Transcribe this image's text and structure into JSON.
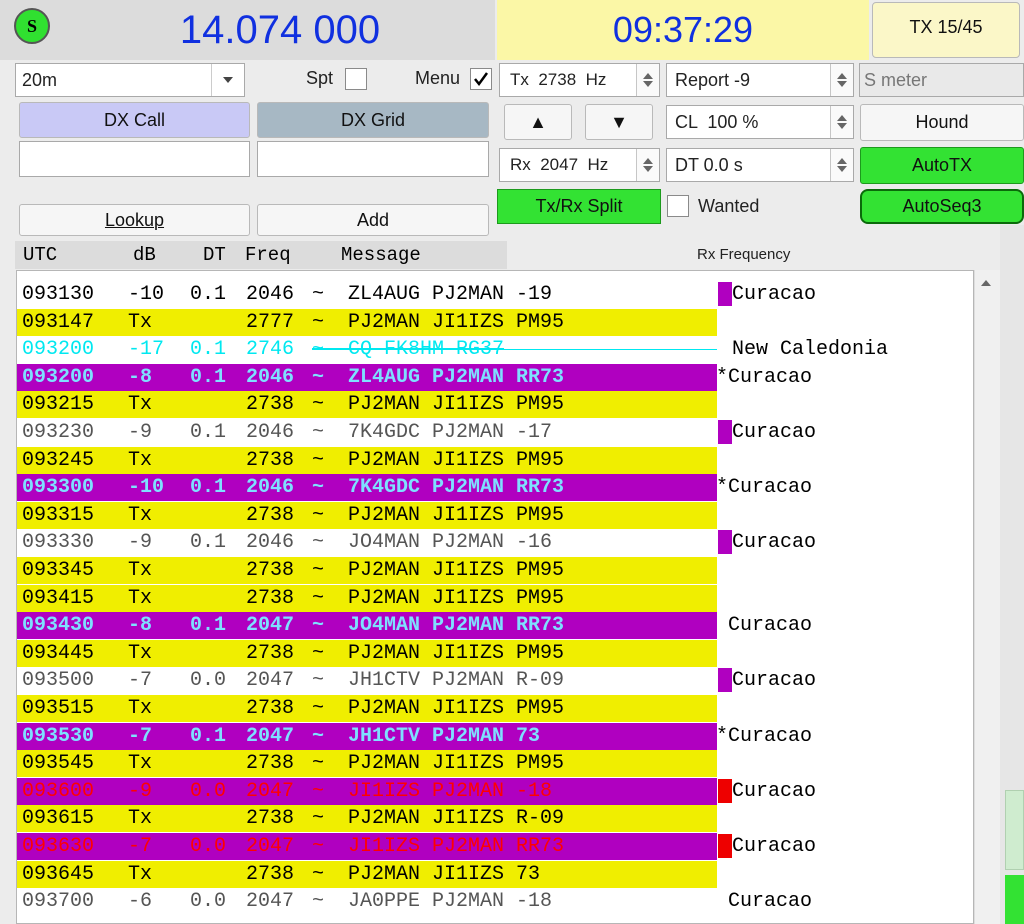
{
  "header": {
    "frequency": "14.074 000",
    "clock": "09:37:29",
    "tx_status": "TX 15/45",
    "s_indicator": "S"
  },
  "controls": {
    "band": "20m",
    "spt_label": "Spt",
    "menu_label": "Menu",
    "tx_freq": "Tx  2738  Hz",
    "rx_freq": "Rx  2047  Hz",
    "report": "Report -9",
    "s_meter_placeholder": "S meter",
    "cl": "CL  100 %",
    "dt": "DT 0.0 s",
    "hound": "Hound",
    "autotx": "AutoTX",
    "autoseq": "AutoSeq3",
    "split": "Tx/Rx Split",
    "wanted": "Wanted",
    "dx_call_label": "DX Call",
    "dx_grid_label": "DX Grid",
    "lookup": "Lookup",
    "add": "Add",
    "up_arrow": "▲",
    "down_arrow": "▼"
  },
  "table": {
    "headers": {
      "utc": "UTC",
      "db": "dB",
      "dt": "DT",
      "freq": "Freq",
      "message": "Message",
      "rx_frequency": "Rx Frequency"
    },
    "rows": [
      {
        "utc": "093130",
        "db": "-10",
        "dt": "0.1",
        "freq": "2046",
        "msg": "~  ZL4AUG PJ2MAN -19",
        "side": "Curacao",
        "style": "plain",
        "marker": "#b000c0"
      },
      {
        "utc": "093147",
        "db": "Tx",
        "dt": "",
        "freq": "2777",
        "msg": "~  PJ2MAN JI1IZS PM95",
        "side": "",
        "style": "tx",
        "marker": ""
      },
      {
        "utc": "093200",
        "db": "-17",
        "dt": "0.1",
        "freq": "2746",
        "msg": "~  CQ FK8HM RG37",
        "side": "New Caledonia",
        "style": "cq",
        "marker": ""
      },
      {
        "utc": "093200",
        "db": "-8",
        "dt": "0.1",
        "freq": "2046",
        "msg": "~  ZL4AUG PJ2MAN RR73",
        "side": "*Curacao",
        "style": "purple",
        "marker": ""
      },
      {
        "utc": "093215",
        "db": "Tx",
        "dt": "",
        "freq": "2738",
        "msg": "~  PJ2MAN JI1IZS PM95",
        "side": "",
        "style": "tx",
        "marker": ""
      },
      {
        "utc": "093230",
        "db": "-9",
        "dt": "0.1",
        "freq": "2046",
        "msg": "~  7K4GDC PJ2MAN -17",
        "side": "Curacao",
        "style": "grey",
        "marker": "#b000c0"
      },
      {
        "utc": "093245",
        "db": "Tx",
        "dt": "",
        "freq": "2738",
        "msg": "~  PJ2MAN JI1IZS PM95",
        "side": "",
        "style": "tx",
        "marker": ""
      },
      {
        "utc": "093300",
        "db": "-10",
        "dt": "0.1",
        "freq": "2046",
        "msg": "~  7K4GDC PJ2MAN RR73",
        "side": "*Curacao",
        "style": "purple",
        "marker": ""
      },
      {
        "utc": "093315",
        "db": "Tx",
        "dt": "",
        "freq": "2738",
        "msg": "~  PJ2MAN JI1IZS PM95",
        "side": "",
        "style": "tx",
        "marker": ""
      },
      {
        "utc": "093330",
        "db": "-9",
        "dt": "0.1",
        "freq": "2046",
        "msg": "~  JO4MAN PJ2MAN -16",
        "side": "Curacao",
        "style": "grey",
        "marker": "#b000c0"
      },
      {
        "utc": "093345",
        "db": "Tx",
        "dt": "",
        "freq": "2738",
        "msg": "~  PJ2MAN JI1IZS PM95",
        "side": "",
        "style": "tx",
        "marker": ""
      },
      {
        "utc": "093415",
        "db": "Tx",
        "dt": "",
        "freq": "2738",
        "msg": "~  PJ2MAN JI1IZS PM95",
        "side": "",
        "style": "tx",
        "marker": ""
      },
      {
        "utc": "093430",
        "db": "-8",
        "dt": "0.1",
        "freq": "2047",
        "msg": "~  JO4MAN PJ2MAN RR73",
        "side": " Curacao",
        "style": "purple",
        "marker": ""
      },
      {
        "utc": "093445",
        "db": "Tx",
        "dt": "",
        "freq": "2738",
        "msg": "~  PJ2MAN JI1IZS PM95",
        "side": "",
        "style": "tx",
        "marker": ""
      },
      {
        "utc": "093500",
        "db": "-7",
        "dt": "0.0",
        "freq": "2047",
        "msg": "~  JH1CTV PJ2MAN R-09",
        "side": "Curacao",
        "style": "grey",
        "marker": "#b000c0"
      },
      {
        "utc": "093515",
        "db": "Tx",
        "dt": "",
        "freq": "2738",
        "msg": "~  PJ2MAN JI1IZS PM95",
        "side": "",
        "style": "tx",
        "marker": ""
      },
      {
        "utc": "093530",
        "db": "-7",
        "dt": "0.1",
        "freq": "2047",
        "msg": "~  JH1CTV PJ2MAN 73",
        "side": "*Curacao",
        "style": "purple",
        "marker": ""
      },
      {
        "utc": "093545",
        "db": "Tx",
        "dt": "",
        "freq": "2738",
        "msg": "~  PJ2MAN JI1IZS PM95",
        "side": "",
        "style": "tx",
        "marker": ""
      },
      {
        "utc": "093600",
        "db": "-9",
        "dt": "0.0",
        "freq": "2047",
        "msg": "~  JI1IZS PJ2MAN -18",
        "side": "Curacao",
        "style": "red",
        "marker": "#ee0000"
      },
      {
        "utc": "093615",
        "db": "Tx",
        "dt": "",
        "freq": "2738",
        "msg": "~  PJ2MAN JI1IZS R-09",
        "side": "",
        "style": "tx",
        "marker": ""
      },
      {
        "utc": "093630",
        "db": "-7",
        "dt": "0.0",
        "freq": "2047",
        "msg": "~  JI1IZS PJ2MAN RR73",
        "side": "Curacao",
        "style": "red",
        "marker": "#ee0000"
      },
      {
        "utc": "093645",
        "db": "Tx",
        "dt": "",
        "freq": "2738",
        "msg": "~  PJ2MAN JI1IZS 73",
        "side": "",
        "style": "tx",
        "marker": ""
      },
      {
        "utc": "093700",
        "db": "-6",
        "dt": "0.0",
        "freq": "2047",
        "msg": "~  JA0PPE PJ2MAN -18",
        "side": " Curacao",
        "style": "grey",
        "marker": ""
      }
    ]
  },
  "colors": {
    "tx_row": "#f0ee00",
    "purple_row": "#b000c0",
    "purple_text": "#7ee0ff",
    "red_text": "#ff0000",
    "cq_text": "#00e8f0",
    "green_button": "#33e233",
    "dx_call_bg": "#c9c9f6",
    "dx_grid_bg": "#a7b8c4",
    "clock_bg": "#fbf7a6",
    "freq_color": "#1030e0"
  }
}
